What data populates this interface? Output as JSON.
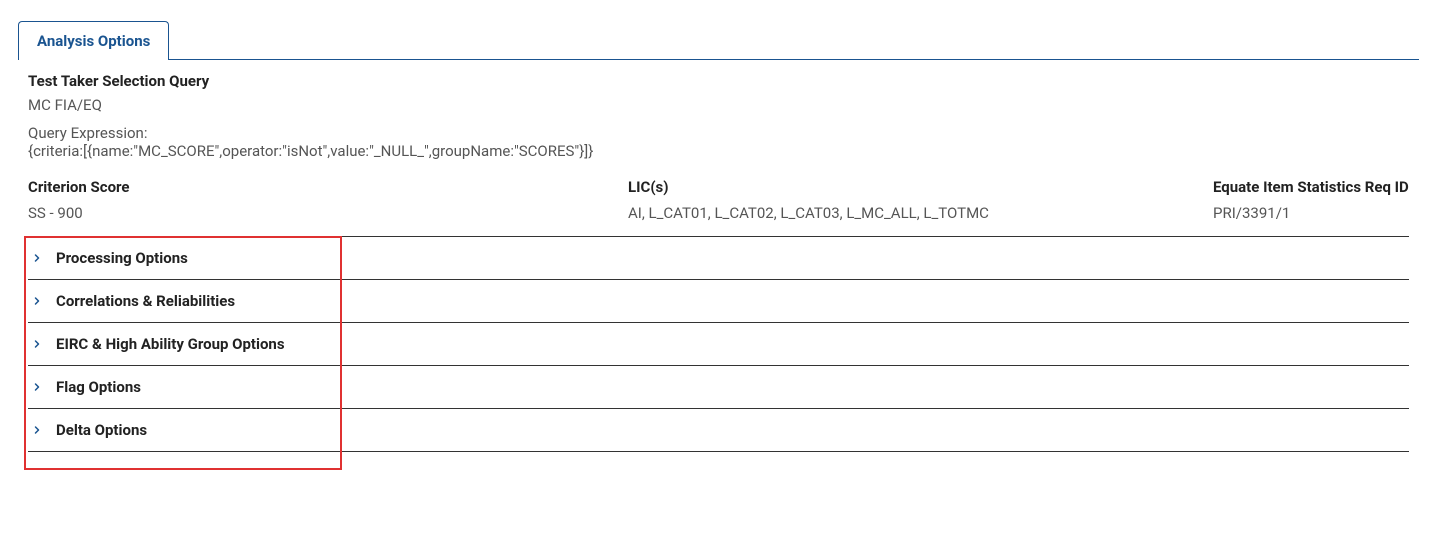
{
  "tabs": {
    "analysis_options": "Analysis Options"
  },
  "query_section": {
    "title_label": "Test Taker Selection Query",
    "title_value": "MC FIA/EQ",
    "expression_label": "Query Expression:",
    "expression_value": "{criteria:[{name:\"MC_SCORE\",operator:\"isNot\",value:\"_NULL_\",groupName:\"SCORES\"}]}"
  },
  "columns": {
    "criterion_label": "Criterion Score",
    "criterion_value": "SS - 900",
    "lic_label": "LIC(s)",
    "lic_value": "AI, L_CAT01, L_CAT02, L_CAT03, L_MC_ALL, L_TOTMC",
    "equate_label": "Equate Item Statistics Req ID",
    "equate_value": "PRI/3391/1"
  },
  "accordion": [
    {
      "label": "Processing Options"
    },
    {
      "label": "Correlations & Reliabilities"
    },
    {
      "label": "EIRC & High Ability Group Options"
    },
    {
      "label": "Flag Options"
    },
    {
      "label": "Delta Options"
    }
  ]
}
